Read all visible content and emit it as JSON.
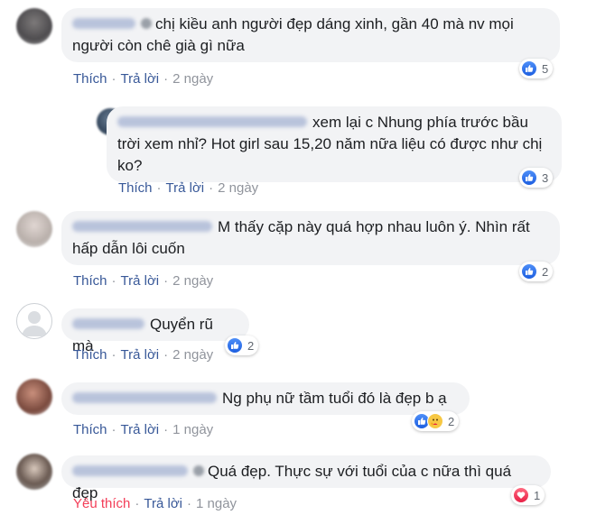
{
  "actions": {
    "like": "Thích",
    "love": "Yêu thích",
    "reply": "Trả lời",
    "separator": "·"
  },
  "comments": [
    {
      "text": "chị kiều anh người đẹp dáng xinh, gần 40 mà nv mọi người còn chê già gì nữa",
      "time": "2 ngày",
      "reaction_count": "5"
    },
    {
      "text": "xem lại c Nhung phía trước bầu trời xem nhỉ? Hot girl sau 15,20 năm nữa liệu có được như chị ko?",
      "time": "2 ngày",
      "reaction_count": "3"
    },
    {
      "text": "M thấy cặp này quá hợp nhau luôn ý. Nhìn rất hấp dẫn lôi cuốn",
      "time": "2 ngày",
      "reaction_count": "2"
    },
    {
      "text": "Quyển rũ mà",
      "time": "2 ngày",
      "reaction_count": "2"
    },
    {
      "text": "Ng phụ nữ tầm tuổi đó là đẹp b ạ",
      "time": "1 ngày",
      "reaction_count": "2"
    },
    {
      "text": "Quá đẹp. Thực sự với tuổi của c nữa thì quá đẹp",
      "time": "1 ngày",
      "reaction_count": "1"
    }
  ],
  "colors": {
    "link": "#385898",
    "love_link": "#f33e58",
    "bubble": "#f2f3f5",
    "like_blue": "#1d5fe0"
  },
  "icons": {
    "like": "thumbs-up-icon",
    "love": "heart-icon",
    "care": "care-hug-icon"
  }
}
